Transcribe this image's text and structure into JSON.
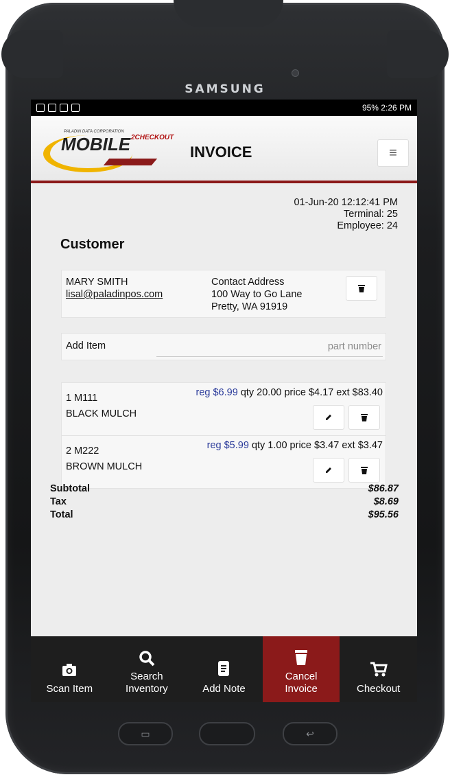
{
  "device": {
    "brand": "SAMSUNG"
  },
  "statusbar": {
    "right": "95% 2:26 PM"
  },
  "header": {
    "logo_small": "PALADIN DATA CORPORATION",
    "logo_main": "MOBILE",
    "logo_sup": "2CHECKOUT",
    "title": "INVOICE",
    "menu_icon": "hamburger-menu-icon"
  },
  "meta": {
    "datetime": "01-Jun-20 12:12:41 PM",
    "terminal": "Terminal: 25",
    "employee": "Employee: 24"
  },
  "customer": {
    "heading": "Customer",
    "name": "MARY SMITH",
    "email": "lisal@paladinpos.com",
    "address_label": "Contact Address",
    "address_line1": "100 Way to Go Lane",
    "address_line2": "Pretty, WA  91919"
  },
  "add_item": {
    "label": "Add Item",
    "placeholder": "part number",
    "value": ""
  },
  "items": [
    {
      "num": "1 M111",
      "desc": "BLACK MULCH",
      "reg": "reg $6.99",
      "detail": "qty 20.00 price $4.17 ext $83.40"
    },
    {
      "num": "2 M222",
      "desc": "BROWN MULCH",
      "reg": "reg $5.99",
      "detail": "qty 1.00 price $3.47 ext $3.47"
    }
  ],
  "totals": {
    "subtotal_label": "Subtotal",
    "subtotal": "$86.87",
    "tax_label": "Tax",
    "tax": "$8.69",
    "total_label": "Total",
    "total": "$95.56"
  },
  "nav": {
    "scan": "Scan Item",
    "search_1": "Search",
    "search_2": "Inventory",
    "note": "Add Note",
    "cancel_1": "Cancel",
    "cancel_2": "Invoice",
    "checkout": "Checkout"
  },
  "colors": {
    "accent": "#8b1a1a",
    "reg_price": "#2a3a9a",
    "nav_bg": "#1e1e1e"
  }
}
